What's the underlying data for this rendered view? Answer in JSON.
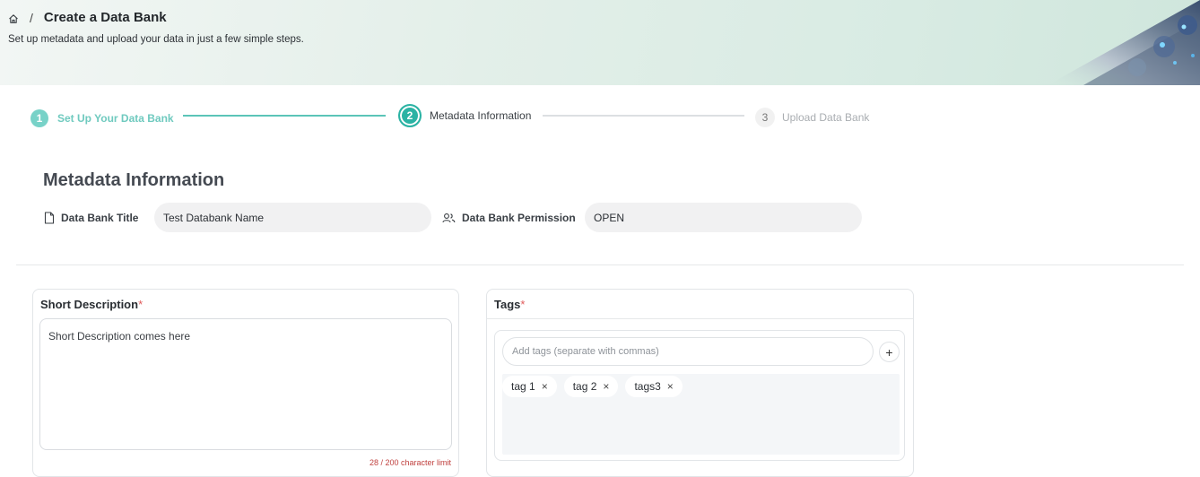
{
  "header": {
    "breadcrumb_separator": "/",
    "title": "Create a Data Bank",
    "subtitle": "Set up metadata and upload your data in just a few simple steps."
  },
  "stepper": {
    "steps": [
      {
        "number": "1",
        "label": "Set Up Your Data Bank",
        "state": "completed"
      },
      {
        "number": "2",
        "label": "Metadata Information",
        "state": "active"
      },
      {
        "number": "3",
        "label": "Upload Data Bank",
        "state": "pending"
      }
    ],
    "colors": {
      "completed": "#78d2c8",
      "active": "#2bb3a4",
      "pending": "#d6d9dc"
    }
  },
  "metadata": {
    "section_title": "Metadata Information",
    "title_label": "Data Bank Title",
    "title_value": "Test Databank Name",
    "permission_label": "Data Bank Permission",
    "permission_value": "OPEN"
  },
  "short_description": {
    "label": "Short Description",
    "required_mark": "*",
    "value": "Short Description comes here",
    "char_limit_text": "28 / 200 character limit"
  },
  "tags": {
    "label": "Tags",
    "required_mark": "*",
    "input_placeholder": "Add tags (separate with commas)",
    "add_button": "+",
    "items": [
      "tag 1",
      "tag 2",
      "tags3"
    ],
    "remove_glyph": "×"
  },
  "icons": {
    "home": "home-icon",
    "title": "document-icon",
    "permission": "users-icon"
  }
}
